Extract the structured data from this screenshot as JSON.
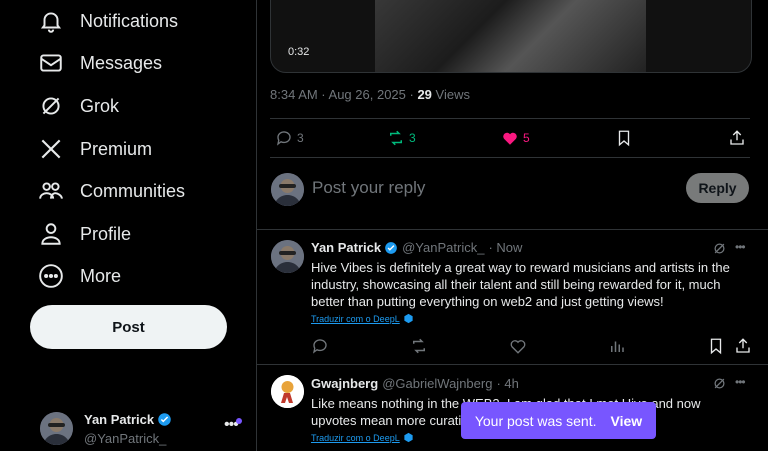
{
  "nav": {
    "notifications": "Notifications",
    "messages": "Messages",
    "grok": "Grok",
    "premium": "Premium",
    "communities": "Communities",
    "profile": "Profile",
    "more": "More",
    "post_button": "Post"
  },
  "account": {
    "name": "Yan Patrick",
    "handle": "@YanPatrick_"
  },
  "video": {
    "duration": "0:32"
  },
  "tweet": {
    "timestamp": "8:34 AM · Aug 26, 2025 · ",
    "views_count": "29",
    "views_label": " Views",
    "replies": "3",
    "reposts": "3",
    "likes": "5"
  },
  "composer": {
    "placeholder": "Post your reply",
    "reply_button": "Reply"
  },
  "replies": [
    {
      "name": "Yan Patrick",
      "handle": "@YanPatrick_",
      "time": "· Now",
      "text": "Hive Vibes is definitely a great way to reward musicians and artists in the industry, showcasing all their talent and still being rewarded for it, much better than putting everything on web2 and just getting views!",
      "translate": "Traduzir com o DeepL"
    },
    {
      "name": "Gwajnberg",
      "handle": "@GabrielWajnberg",
      "time": "· 4h",
      "text": "Like means nothing in the WEB2. I am glad that I met Hive and now upvotes mean more curating rewards",
      "translate": "Traduzir com o DeepL"
    }
  ],
  "toast": {
    "message": "Your post was sent.",
    "action": "View"
  },
  "colors": {
    "accent": "#1d9bf0",
    "like": "#f91880",
    "repost": "#00ba7c",
    "toast": "#7856ff"
  }
}
